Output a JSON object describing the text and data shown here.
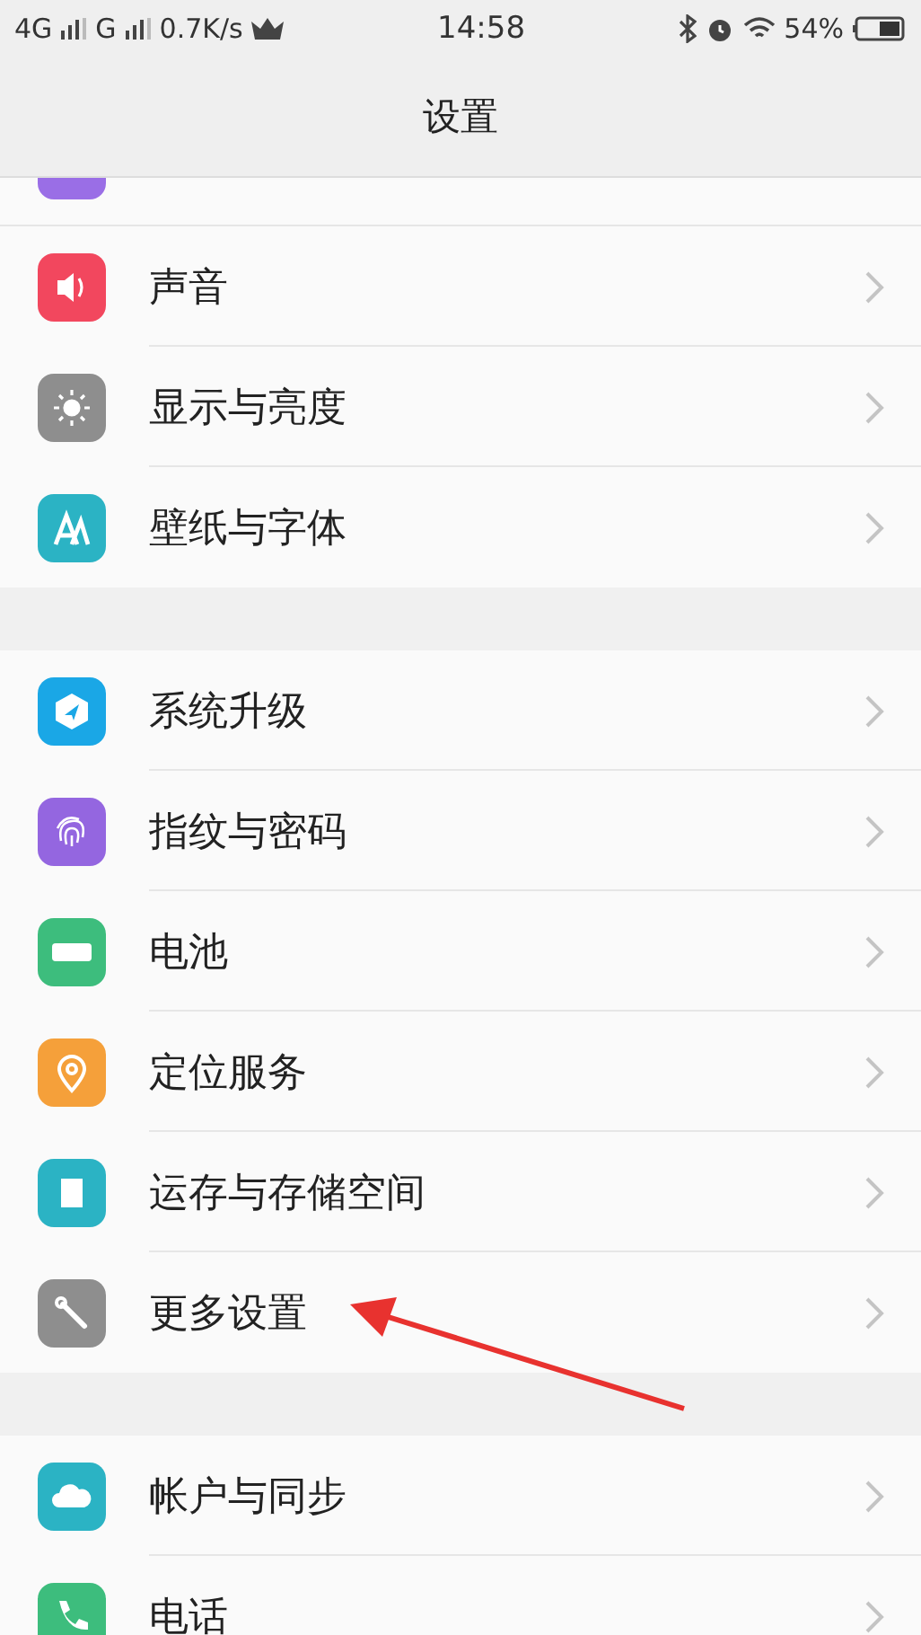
{
  "status_bar": {
    "network_1": "4G",
    "network_2": "G",
    "speed": "0.7K/s",
    "time": "14:58",
    "battery": "54%"
  },
  "header": {
    "title": "设置"
  },
  "groups": [
    {
      "items": [
        {
          "kind": "cut_off"
        },
        {
          "kind": "sound",
          "label": "声音"
        },
        {
          "kind": "brightness",
          "label": "显示与亮度"
        },
        {
          "kind": "font",
          "label": "壁纸与字体"
        }
      ]
    },
    {
      "items": [
        {
          "kind": "update",
          "label": "系统升级"
        },
        {
          "kind": "fingerprint",
          "label": "指纹与密码"
        },
        {
          "kind": "battery",
          "label": "电池"
        },
        {
          "kind": "location",
          "label": "定位服务"
        },
        {
          "kind": "storage",
          "label": "运存与存储空间"
        },
        {
          "kind": "wrench",
          "label": "更多设置"
        }
      ]
    },
    {
      "items": [
        {
          "kind": "cloud",
          "label": "帐户与同步"
        },
        {
          "kind": "phone",
          "label": "电话"
        }
      ]
    }
  ],
  "arrow_annotation": true
}
